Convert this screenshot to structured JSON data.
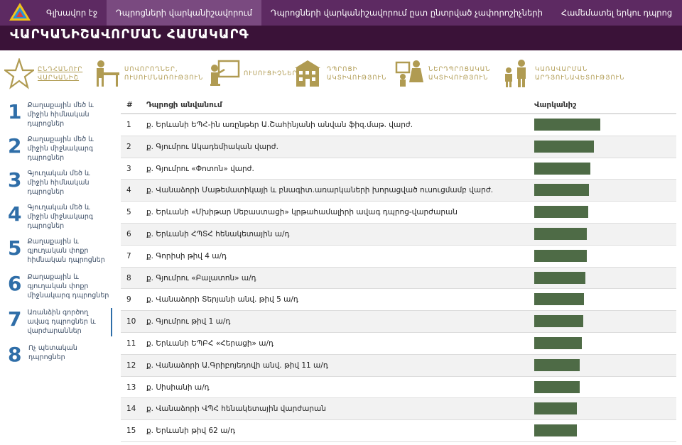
{
  "nav": {
    "items": [
      {
        "label": "Գլխավոր էջ",
        "active": false
      },
      {
        "label": "Դպրոցների վարկանիշավորում",
        "active": true
      },
      {
        "label": "Դպրոցների վարկանիշավորում ըստ ընտրված չափորոշիչների",
        "active": false
      },
      {
        "label": "Համեմատել երկու դպրոց",
        "active": false
      }
    ]
  },
  "banner": {
    "title": "ՎԱՐԿԱՆԻՇԱՎՈՐՄԱՆ ՀԱՄԱԿԱՐԳ"
  },
  "categories": [
    {
      "line1": "ԸՆԴՀԱՆՈՒՐ",
      "line2": "ՎԱՐԿԱՆԻՇ",
      "icon": "star-icon",
      "active": true
    },
    {
      "line1": "ՍՈՎՈՐՈՂՆԵՐ,",
      "line2": "ՈՒՍՈՒՄՆԱՌՈՒԹՅՈՒՆ",
      "icon": "student-desk-icon",
      "active": false
    },
    {
      "line1": "ՈՒՍՈՒՑԻՉՆԵՐ",
      "line2": "",
      "icon": "teacher-board-icon",
      "active": false
    },
    {
      "line1": "ԴՊՐՈՑԻ",
      "line2": "ԱԿՏԻՎՈՒԹՅՈՒՆ",
      "icon": "school-building-icon",
      "active": false
    },
    {
      "line1": "ՆԵՐԴՊՐՈՑԱԿԱՆ",
      "line2": "ԱԿՏԻՎՈՒԹՅՈՒՆ",
      "icon": "people-board-icon",
      "active": false
    },
    {
      "line1": "ԿԱՌԱՎԱՐՄԱՆ",
      "line2": "ԱՐԴՅՈՒՆԱՎԵՏՈՒԹՅՈՒՆ",
      "icon": "family-icon",
      "active": false
    }
  ],
  "sidebar": {
    "items": [
      {
        "num": "1",
        "label": "Քաղաքային մեծ և միջին հիմնական դպրոցներ",
        "active": false
      },
      {
        "num": "2",
        "label": "Քաղաքային մեծ և միջին միջնակարգ դպրոցներ",
        "active": false
      },
      {
        "num": "3",
        "label": "Գյուղական մեծ և միջին հիմնական դպրոցներ",
        "active": false
      },
      {
        "num": "4",
        "label": "Գյուղական մեծ և միջին միջնակարգ դպրոցներ",
        "active": false
      },
      {
        "num": "5",
        "label": "Քաղաքային և գյուղական փոքր հիմնական դպրոցներ",
        "active": false
      },
      {
        "num": "6",
        "label": "Քաղաքային և գյուղական փոքր միջնակարգ դպրոցներ",
        "active": false
      },
      {
        "num": "7",
        "label": "Առանձին գործող ավագ դպրոցներ և վարժարաններ",
        "active": true
      },
      {
        "num": "8",
        "label": "Ոչ պետական դպրոցներ",
        "active": false
      }
    ]
  },
  "table": {
    "headers": {
      "num": "#",
      "name": "Դպրոցի անվանում",
      "rank": "Վարկանիշ"
    },
    "rows": [
      {
        "num": "1",
        "name": "ք. Երևանի ԵՊՀ-ին առընթեր Ա.Շահինյանի անվան ֆիզ.մաթ. վարժ.",
        "score": 1.0
      },
      {
        "num": "2",
        "name": "ք. Գյումրու Ակադեմիական վարժ.",
        "score": 0.9
      },
      {
        "num": "3",
        "name": "ք. Գյումրու «Փոտոն» վարժ.",
        "score": 0.85
      },
      {
        "num": "4",
        "name": "ք. Վանաձորի Մաթեմատիկայի և բնագիտ.առարկաների խորացված ուսուցմամբ վարժ.",
        "score": 0.83
      },
      {
        "num": "5",
        "name": "ք. Երևանի «Մխիթար Սեբաստացի» կրթահամալիրի ավագ դպրոց-վարժարան",
        "score": 0.82
      },
      {
        "num": "6",
        "name": "ք. Երևանի ՀՊՏՀ հենակետային ա/դ",
        "score": 0.8
      },
      {
        "num": "7",
        "name": "ք. Գորիսի թիվ 4 ա/դ",
        "score": 0.8
      },
      {
        "num": "8",
        "name": "ք. Գյումրու «Բալատոն» ա/դ",
        "score": 0.77
      },
      {
        "num": "9",
        "name": "ք. Վանաձորի Տերյանի անվ. թիվ 5 ա/դ",
        "score": 0.75
      },
      {
        "num": "10",
        "name": "ք. Գյումրու թիվ 1 ա/դ",
        "score": 0.74
      },
      {
        "num": "11",
        "name": "ք. Երևանի ԵՊԲՀ «Հերացի» ա/դ",
        "score": 0.72
      },
      {
        "num": "12",
        "name": "ք. Վանաձորի Ա.Գրիբոյեդովի անվ. թիվ 11 ա/դ",
        "score": 0.69
      },
      {
        "num": "13",
        "name": "ք. Սիսիանի ա/դ",
        "score": 0.69
      },
      {
        "num": "14",
        "name": "ք. Վանաձորի ՎՊՀ հենակետային վարժարան",
        "score": 0.65
      },
      {
        "num": "15",
        "name": "ք. Երևանի թիվ 62 ա/դ",
        "score": 0.64
      }
    ]
  },
  "colors": {
    "nav_bg": "#5d2a62",
    "banner_bg": "#3a1238",
    "category_gold": "#b09b52",
    "bar": "#4e6b46",
    "sidebar_blue": "#2f6ea8"
  }
}
